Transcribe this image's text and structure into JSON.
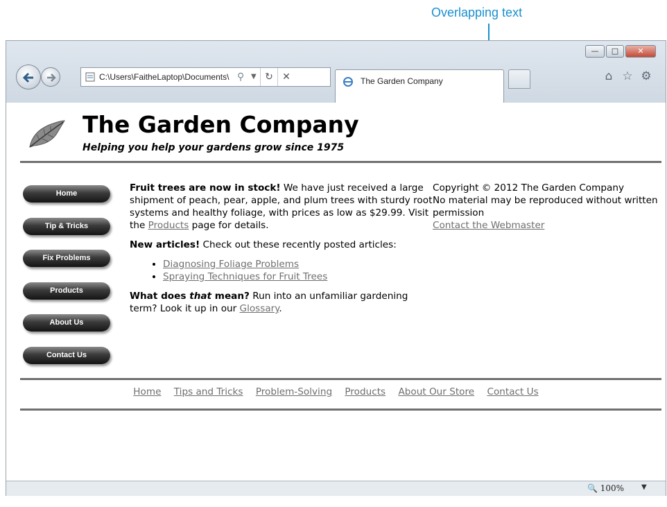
{
  "callout": {
    "label": "Overlapping text"
  },
  "browser": {
    "address": "C:\\Users\\FaitheLaptop\\Documents\\",
    "tab_title": "The Garden Company",
    "zoom": "100%"
  },
  "site": {
    "title": "The Garden Company",
    "tagline": "Helping you help your gardens grow since 1975"
  },
  "nav": [
    {
      "label": "Home"
    },
    {
      "label": "Tip & Tricks"
    },
    {
      "label": "Fix Problems"
    },
    {
      "label": "Products"
    },
    {
      "label": "About Us"
    },
    {
      "label": "Contact Us"
    }
  ],
  "main": {
    "p1_bold": "Fruit trees are now in stock!",
    "p1_text": " We have just received a large shipment of peach, pear, apple, and plum trees with sturdy root systems and healthy foliage, with prices as low as $29.99. Visit the ",
    "p1_link": "Products",
    "p1_end": " page for details.",
    "p2_bold": "New articles!",
    "p2_text": " Check out these recently posted articles:",
    "articles": [
      "Diagnosing Foliage Problems",
      "Spraying Techniques for Fruit Trees"
    ],
    "p3_bold_a": "What does ",
    "p3_bold_i": "that",
    "p3_bold_b": " mean?",
    "p3_text": " Run into an unfamiliar gardening term? Look it up in our ",
    "p3_link": "Glossary",
    "p3_end": "."
  },
  "aside": {
    "copyright": "Copyright © 2012 The Garden Company",
    "notice": "No material may be reproduced without written permission",
    "contact_link": "Contact the Webmaster"
  },
  "footer": [
    "Home",
    "Tips and Tricks",
    "Problem-Solving",
    "Products",
    "About Our Store",
    "Contact Us"
  ]
}
